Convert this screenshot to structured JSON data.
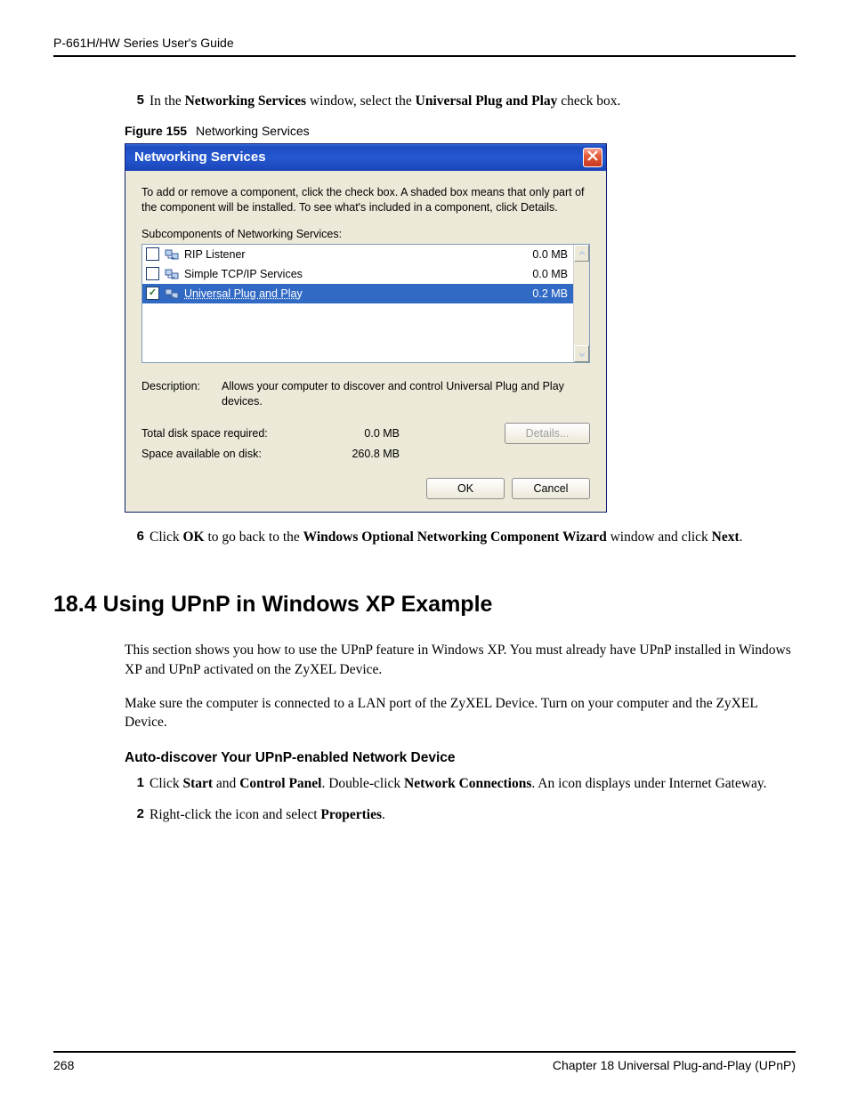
{
  "header": {
    "guide_title": "P-661H/HW Series User's Guide"
  },
  "step5": {
    "num": "5",
    "pre": "In the ",
    "b1": "Networking Services",
    "mid": " window, select the ",
    "b2": "Universal Plug and Play",
    "post": " check box."
  },
  "figure": {
    "label": "Figure 155",
    "caption": "Networking Services"
  },
  "dialog": {
    "title": "Networking Services",
    "help": "To add or remove a component, click the check box. A shaded box means that only part of the component will be installed. To see what's included in a component, click Details.",
    "sub_label": "Subcomponents of Networking Services:",
    "items": [
      {
        "name": "RIP Listener",
        "size": "0.0 MB",
        "checked": false,
        "selected": false
      },
      {
        "name": "Simple TCP/IP Services",
        "size": "0.0 MB",
        "checked": false,
        "selected": false
      },
      {
        "name": "Universal Plug and Play",
        "size": "0.2 MB",
        "checked": true,
        "selected": true
      }
    ],
    "desc_label": "Description:",
    "desc_text": "Allows your computer to discover and control Universal Plug and Play devices.",
    "disk_req_label": "Total disk space required:",
    "disk_req_val": "0.0 MB",
    "disk_avail_label": "Space available on disk:",
    "disk_avail_val": "260.8 MB",
    "details_btn": "Details...",
    "ok_btn": "OK",
    "cancel_btn": "Cancel"
  },
  "step6": {
    "num": "6",
    "t1": "Click ",
    "b1": "OK",
    "t2": " to go back to the ",
    "b2": "Windows Optional Networking Component Wizard",
    "t3": " window and click ",
    "b3": "Next",
    "t4": "."
  },
  "section": {
    "heading": "18.4  Using UPnP in Windows XP Example",
    "para1": "This section shows you how to use the UPnP feature in Windows XP. You must already have UPnP installed in Windows XP and UPnP activated on the ZyXEL Device.",
    "para2": "Make sure the computer is connected to a LAN port of the ZyXEL Device. Turn on your computer and the ZyXEL Device.",
    "subheading": "Auto-discover Your UPnP-enabled Network Device"
  },
  "substep1": {
    "num": "1",
    "t1": "Click ",
    "b1": "Start",
    "t2": " and ",
    "b2": "Control Panel",
    "t3": ". Double-click ",
    "b3": "Network Connections",
    "t4": ". An icon displays under Internet Gateway."
  },
  "substep2": {
    "num": "2",
    "t1": "Right-click the icon and select ",
    "b1": "Properties",
    "t2": "."
  },
  "footer": {
    "page": "268",
    "chapter": "Chapter 18 Universal Plug-and-Play (UPnP)"
  }
}
